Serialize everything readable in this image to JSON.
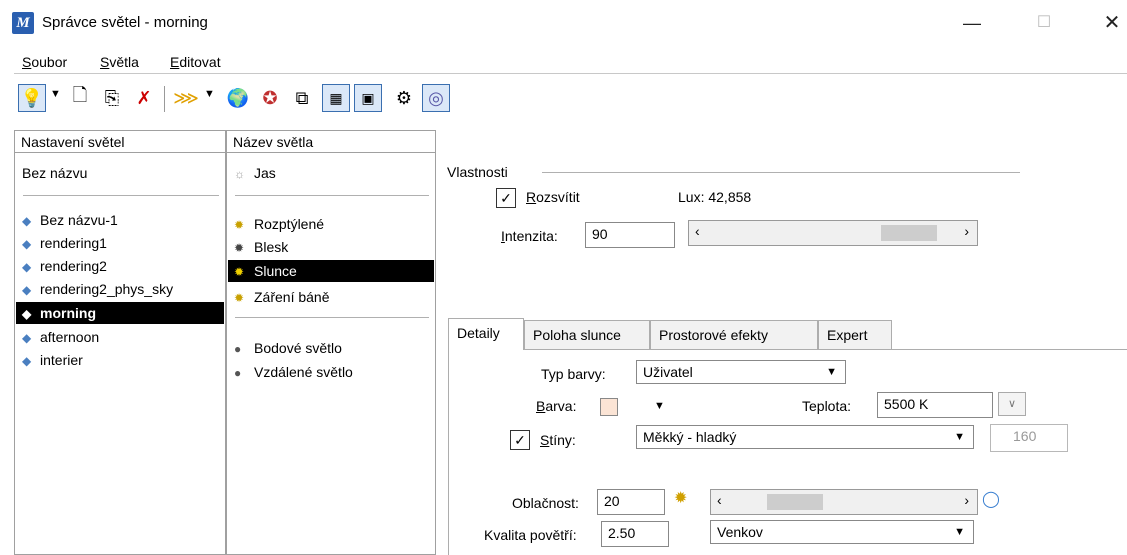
{
  "window": {
    "title": "Správce světel - morning"
  },
  "menu": [
    {
      "u": "S",
      "rest": "oubor"
    },
    {
      "u": "S",
      "rest": "větla"
    },
    {
      "u": "E",
      "rest": "ditovat"
    }
  ],
  "left_panel": {
    "header": "Nastavení světel",
    "top_item": "Bez názvu",
    "items": [
      "Bez názvu-1",
      "rendering1",
      "rendering2",
      "rendering2_phys_sky",
      "morning",
      "afternoon",
      "interier"
    ],
    "selected": "morning"
  },
  "mid_panel": {
    "header": "Název světla",
    "top_item": "Jas",
    "group1": [
      "Rozptýlené",
      "Blesk",
      "Slunce",
      "Záření báně"
    ],
    "group2": [
      "Bodové světlo",
      "Vzdálené světlo"
    ],
    "selected": "Slunce"
  },
  "properties": {
    "group_title": "Vlastnosti",
    "enable_label_u": "R",
    "enable_label_rest": "ozsvítit",
    "enable_checked": true,
    "lux": "Lux: 42,858",
    "intensity_label_u": "I",
    "intensity_label_rest": "ntenzita:",
    "intensity_value": "90"
  },
  "tabs": [
    "Detaily",
    "Poloha slunce",
    "Prostorové efekty",
    "Expert"
  ],
  "active_tab": "Detaily",
  "details": {
    "color_type_label": "Typ barvy:",
    "color_type_value": "Uživatel",
    "color_label_u": "B",
    "color_label_rest": "arva:",
    "temp_label": "Teplota:",
    "temp_value": "5500 K",
    "shadows_label_u": "S",
    "shadows_label_rest": "tíny:",
    "shadows_checked": true,
    "shadows_value": "Měkký - hladký",
    "shadows_samples": "160",
    "cloud_label": "Oblačnost:",
    "cloud_value": "20",
    "air_label": "Kvalita povětří:",
    "air_value": "2.50",
    "air_type": "Venkov"
  },
  "colors": {
    "selection": "#000000",
    "swatch": "#fbe4d5",
    "accent": "#2a5fb0"
  }
}
